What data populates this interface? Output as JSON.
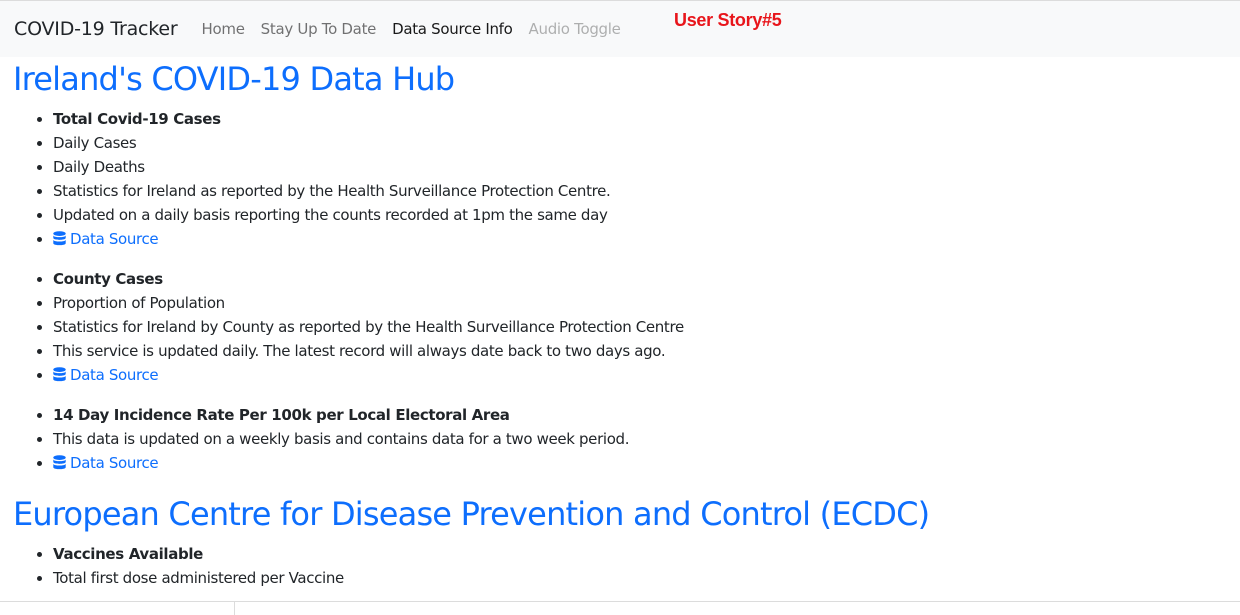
{
  "nav": {
    "brand": "COVID-19 Tracker",
    "links": [
      "Home",
      "Stay Up To Date",
      "Data Source Info",
      "Audio Toggle"
    ],
    "active_link": "Data Source Info",
    "disabled_link": "Audio Toggle"
  },
  "annotation": "User Story#5",
  "ireland": {
    "title": "Ireland's COVID-19 Data Hub",
    "groups": [
      {
        "heading": "Total Covid-19 Cases",
        "items": [
          "Daily Cases",
          "Daily Deaths",
          "Statistics for Ireland as reported by the Health Surveillance Protection Centre.",
          "Updated on a daily basis reporting the counts recorded at 1pm the same day"
        ],
        "link": "Data Source"
      },
      {
        "heading": "County Cases",
        "items": [
          "Proportion of Population",
          "Statistics for Ireland by County as reported by the Health Surveillance Protection Centre",
          "This service is updated daily. The latest record will always date back to two days ago."
        ],
        "link": "Data Source"
      },
      {
        "heading": "14 Day Incidence Rate Per 100k per Local Electoral Area",
        "items": [
          "This data is updated on a weekly basis and contains data for a two week period."
        ],
        "link": "Data Source"
      }
    ]
  },
  "ecdc": {
    "title": "European Centre for Disease Prevention and Control (ECDC)",
    "groups": [
      {
        "heading": "Vaccines Available",
        "items": [
          "Total first dose administered per Vaccine"
        ]
      }
    ]
  },
  "icons": {
    "data_source": "database-icon"
  },
  "colors": {
    "link": "#0d6efd",
    "annotation": "#e8151b",
    "navbar_bg": "#f8f9fa"
  }
}
